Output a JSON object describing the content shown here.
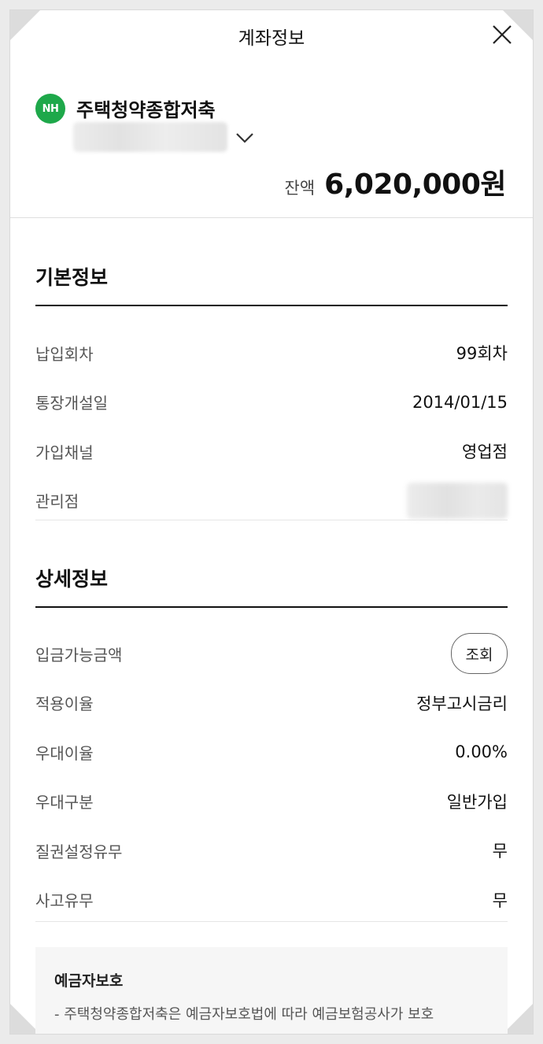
{
  "header": {
    "title": "계좌정보",
    "close_icon": "close-icon"
  },
  "account": {
    "bank_logo_text": "NH",
    "bank_logo_color": "#1ea84a",
    "product_name": "주택청약종합저축",
    "balance_label": "잔액",
    "balance_value": "6,020,000원"
  },
  "basic_info": {
    "title": "기본정보",
    "rows": [
      {
        "label": "납입회차",
        "value": "99회차"
      },
      {
        "label": "통장개설일",
        "value": "2014/01/15"
      },
      {
        "label": "가입채널",
        "value": "영업점"
      },
      {
        "label": "관리점",
        "value": ""
      }
    ]
  },
  "detail_info": {
    "title": "상세정보",
    "rows": [
      {
        "label": "입금가능금액",
        "button_label": "조회"
      },
      {
        "label": "적용이율",
        "value": "정부고시금리"
      },
      {
        "label": "우대이율",
        "value": "0.00%"
      },
      {
        "label": "우대구분",
        "value": "일반가입"
      },
      {
        "label": "질권설정유무",
        "value": "무"
      },
      {
        "label": "사고유무",
        "value": "무"
      }
    ]
  },
  "notice": {
    "title": "예금자보호",
    "text": "- 주택청약종합저축은 예금자보호법에 따라 예금보험공사가 보호"
  }
}
